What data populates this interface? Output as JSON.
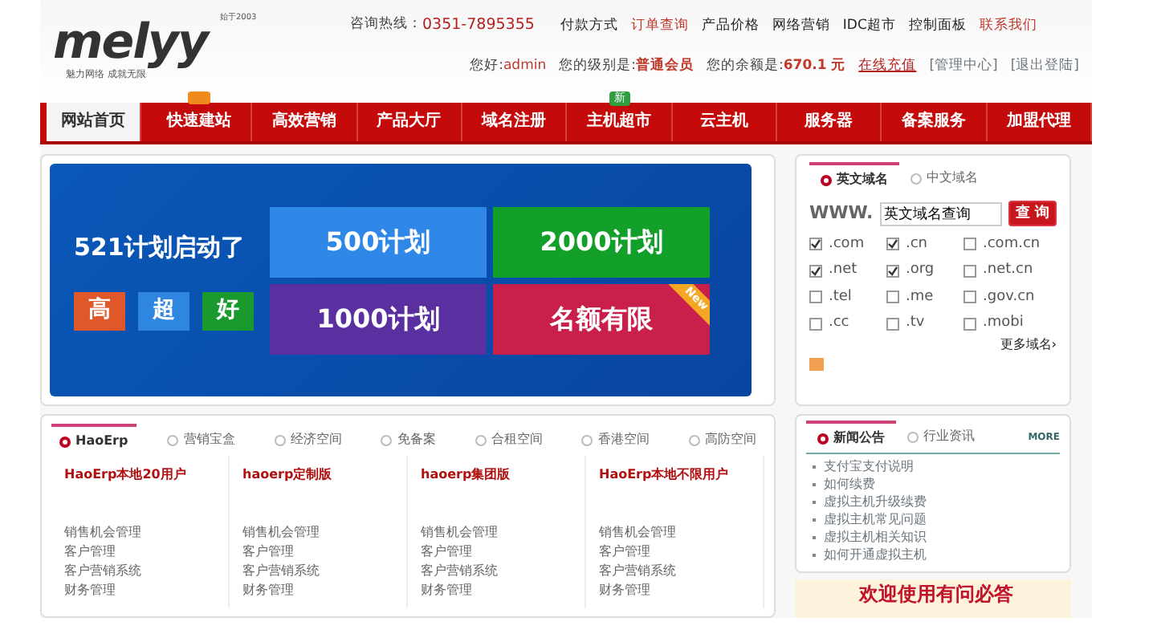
{
  "logo": {
    "text": "melyy",
    "since": "始于2003",
    "slogan": "魅力网络  成就无限"
  },
  "hotline": {
    "label": "咨询热线：",
    "number": "0351-7895355"
  },
  "top_links": [
    {
      "label": "付款方式",
      "highlight": false
    },
    {
      "label": "订单查询",
      "highlight": true
    },
    {
      "label": "产品价格",
      "highlight": false
    },
    {
      "label": "网络营销",
      "highlight": false
    },
    {
      "label": "IDC超市",
      "highlight": false
    },
    {
      "label": "控制面板",
      "highlight": false
    },
    {
      "label": "联系我们",
      "highlight": true
    }
  ],
  "user_bar": {
    "greeting": "您好:",
    "user": "admin",
    "level_label": "您的级别是:",
    "level": "普通会员",
    "balance_label": "您的余额是:",
    "balance": "670.1 元",
    "recharge": "在线充值",
    "links": [
      "[管理中心]",
      "[退出登陆]"
    ]
  },
  "nav": [
    {
      "label": "网站首页",
      "selected": true
    },
    {
      "label": "快速建站",
      "selected": false,
      "badge": {
        "color": "#f08a1c"
      }
    },
    {
      "label": "高效营销",
      "selected": false
    },
    {
      "label": "产品大厅",
      "selected": false
    },
    {
      "label": "域名注册",
      "selected": false
    },
    {
      "label": "主机超市",
      "selected": false,
      "badge": {
        "label": "新",
        "color": "#2e9e3e"
      }
    },
    {
      "label": "云主机",
      "selected": false
    },
    {
      "label": "服务器",
      "selected": false
    },
    {
      "label": "备案服务",
      "selected": false
    },
    {
      "label": "加盟代理",
      "selected": false
    }
  ],
  "banner": {
    "headline": "521计划启动了",
    "tags": [
      {
        "label": "高",
        "color": "#e0582a"
      },
      {
        "label": "超",
        "color": "#2e86e0"
      },
      {
        "label": "好",
        "color": "#1a9a2e"
      }
    ],
    "tiles": [
      {
        "label": "500计划",
        "color": "#2f88e8"
      },
      {
        "label": "2000计划",
        "color": "#12a02a"
      },
      {
        "label": "1000计划",
        "color": "#5a2fa0"
      },
      {
        "label": "名额有限",
        "color": "#c8204a",
        "ribbon": "New"
      }
    ]
  },
  "domain_search": {
    "tabs": [
      {
        "label": "英文域名",
        "selected": true
      },
      {
        "label": "中文域名",
        "selected": false
      }
    ],
    "prefix": "WWW.",
    "value": "英文域名查询",
    "button": "查 询",
    "suffixes": [
      {
        "label": ".com",
        "checked": true
      },
      {
        "label": ".cn",
        "checked": true
      },
      {
        "label": ".com.cn",
        "checked": false
      },
      {
        "label": ".net",
        "checked": true
      },
      {
        "label": ".org",
        "checked": true
      },
      {
        "label": ".net.cn",
        "checked": false
      },
      {
        "label": ".tel",
        "checked": false
      },
      {
        "label": ".me",
        "checked": false
      },
      {
        "label": ".gov.cn",
        "checked": false
      },
      {
        "label": ".cc",
        "checked": false
      },
      {
        "label": ".tv",
        "checked": false
      },
      {
        "label": ".mobi",
        "checked": false
      }
    ],
    "more": "更多域名›"
  },
  "product_tabs": [
    {
      "label": "HaoErp",
      "selected": true
    },
    {
      "label": "营销宝盒",
      "selected": false
    },
    {
      "label": "经济空间",
      "selected": false
    },
    {
      "label": "免备案",
      "selected": false
    },
    {
      "label": "合租空间",
      "selected": false
    },
    {
      "label": "香港空间",
      "selected": false
    },
    {
      "label": "高防空间",
      "selected": false
    }
  ],
  "products": [
    {
      "title": "HaoErp本地20用户",
      "features": [
        "销售机会管理",
        "客户管理",
        "客户营销系统",
        "财务管理"
      ]
    },
    {
      "title": "haoerp定制版",
      "features": [
        "销售机会管理",
        "客户管理",
        "客户营销系统",
        "财务管理"
      ]
    },
    {
      "title": "haoerp集团版",
      "features": [
        "销售机会管理",
        "客户管理",
        "客户营销系统",
        "财务管理"
      ]
    },
    {
      "title": "HaoErp本地不限用户",
      "features": [
        "销售机会管理",
        "客户管理",
        "客户营销系统",
        "财务管理"
      ]
    }
  ],
  "news": {
    "tabs": [
      {
        "label": "新闻公告",
        "selected": true
      },
      {
        "label": "行业资讯",
        "selected": false
      }
    ],
    "more": "MORE",
    "items": [
      "支付宝支付说明",
      "如何续费",
      "虚拟主机升级续费",
      "虚拟主机常见问题",
      "虚拟主机相关知识",
      "如何开通虚拟主机"
    ]
  },
  "help_banner": {
    "title": "欢迎使用有问必答"
  }
}
